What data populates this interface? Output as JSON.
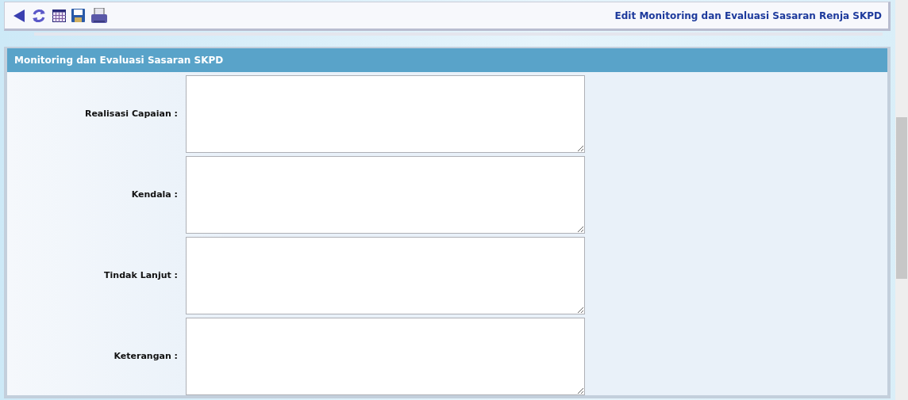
{
  "toolbar": {
    "title": "Edit Monitoring dan Evaluasi Sasaran Renja SKPD"
  },
  "panel": {
    "title": "Monitoring dan Evaluasi Sasaran SKPD",
    "fields": [
      {
        "label": "Realisasi Capaian :"
      },
      {
        "label": "Kendala :"
      },
      {
        "label": "Tindak Lanjut :"
      },
      {
        "label": "Keterangan :"
      }
    ]
  }
}
